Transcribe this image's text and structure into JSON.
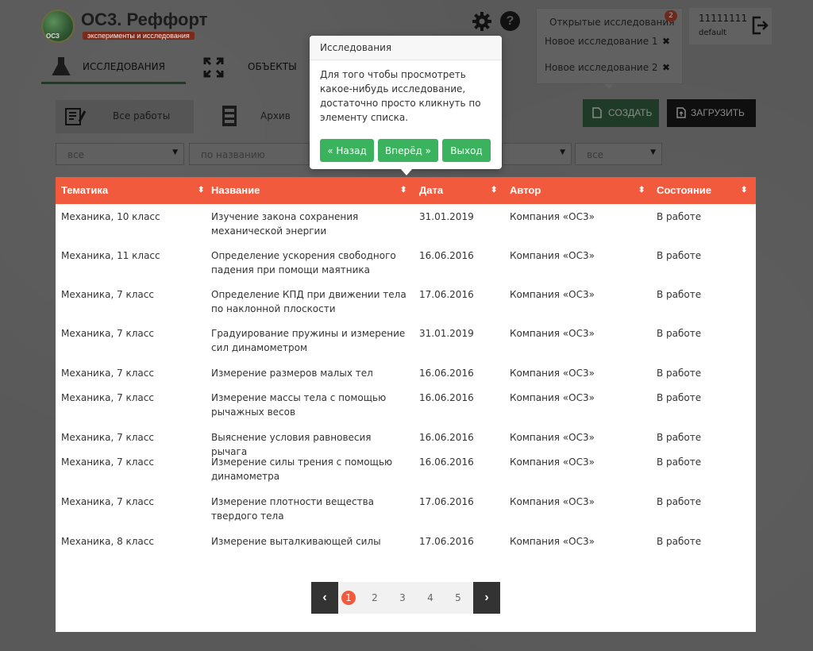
{
  "header": {
    "logo_title": "ОС3. Реффорт",
    "logo_subtitle": "эксперименты и исследования",
    "logo_tag": "ОСЗ",
    "open_research": {
      "title": "Открытые исследования",
      "badge": "2",
      "items": [
        {
          "label": "Новое исследование 1"
        },
        {
          "label": "Новое исследование 2"
        }
      ]
    },
    "user": {
      "name": "11111111",
      "role": "default"
    }
  },
  "nav": {
    "tabs": [
      {
        "label": "ИССЛЕДОВАНИЯ"
      },
      {
        "label": "ОБЪЕКТЫ"
      }
    ]
  },
  "toolbar": {
    "all_works": "Все работы",
    "archive": "Архив",
    "create": "СОЗДАТЬ",
    "upload": "ЗАГРУЗИТЬ"
  },
  "filters": {
    "topic": "все",
    "name": "по названию",
    "author": "",
    "state": "все"
  },
  "table": {
    "columns": [
      "Тематика",
      "Название",
      "Дата",
      "Автор",
      "Состояние"
    ],
    "rows": [
      {
        "topic": "Механика, 10 класс",
        "name": "Изучение закона сохранения механической энергии",
        "date": "31.01.2019",
        "author": "Компания «ОС3»",
        "state": "В работе"
      },
      {
        "topic": "Механика, 11 класс",
        "name": "Определение ускорения свободного падения при помощи маятника",
        "date": "16.06.2016",
        "author": "Компания «ОС3»",
        "state": "В работе"
      },
      {
        "topic": "Механика, 7 класс",
        "name": "Определение КПД при движении тела по наклонной плоскости",
        "date": "17.06.2016",
        "author": "Компания «ОС3»",
        "state": "В работе"
      },
      {
        "topic": "Механика, 7 класс",
        "name": "Градуирование пружины и измерение сил динамометром",
        "date": "31.01.2019",
        "author": "Компания «ОС3»",
        "state": "В работе"
      },
      {
        "topic": "Механика, 7 класс",
        "name": "Измерение размеров малых тел",
        "date": "16.06.2016",
        "author": "Компания «ОС3»",
        "state": "В работе"
      },
      {
        "topic": "Механика, 7 класс",
        "name": "Измерение массы тела с помощью рычажных весов",
        "date": "16.06.2016",
        "author": "Компания «ОС3»",
        "state": "В работе"
      },
      {
        "topic": "Механика, 7 класс",
        "name": "Выяснение условия равновесия рычага",
        "date": "16.06.2016",
        "author": "Компания «ОС3»",
        "state": "В работе"
      },
      {
        "topic": "Механика, 7 класс",
        "name": "Измерение силы трения с помощью динамометра",
        "date": "16.06.2016",
        "author": "Компания «ОС3»",
        "state": "В работе"
      },
      {
        "topic": "Механика, 7 класс",
        "name": "Измерение плотности вещества твердого тела",
        "date": "17.06.2016",
        "author": "Компания «ОС3»",
        "state": "В работе"
      },
      {
        "topic": "Механика, 8 класс",
        "name": "Измерение выталкивающей силы",
        "date": "17.06.2016",
        "author": "Компания «ОС3»",
        "state": "В работе"
      }
    ]
  },
  "pagination": {
    "pages": [
      "1",
      "2",
      "3",
      "4",
      "5"
    ],
    "current": "1",
    "prev": "‹",
    "next": "›"
  },
  "popover": {
    "title": "Исследования",
    "text": "Для того чтобы просмотреть какое-нибудь исследование, достаточно просто кликнуть по элементу списка.",
    "back": "« Назад",
    "next": "Вперёд »",
    "exit": "Выход"
  },
  "colors": {
    "accent": "#f25a3e",
    "button_green": "#3bb25e",
    "overlay": "#5f5f5f"
  }
}
